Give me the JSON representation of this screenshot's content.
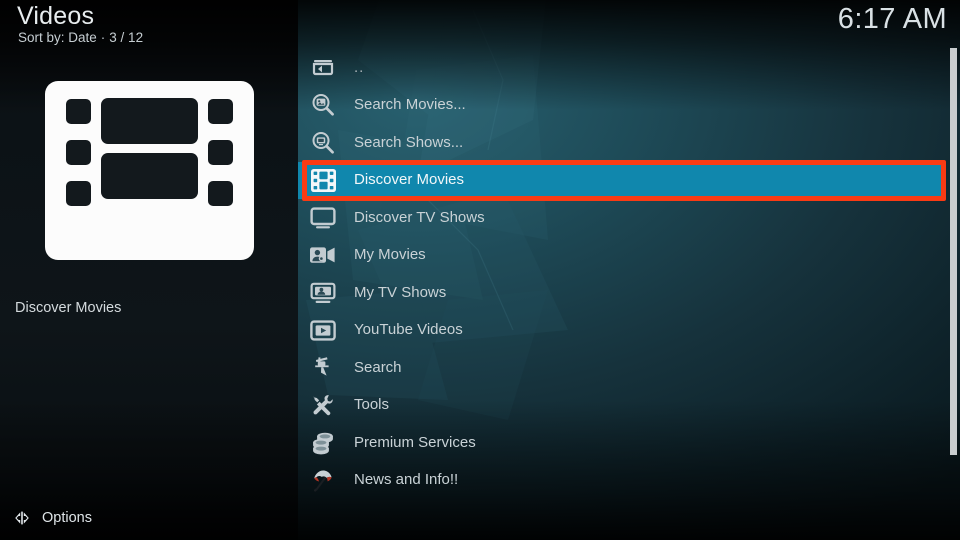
{
  "header": {
    "title": "Videos",
    "sort_label": "Sort by: Date",
    "separator": "·",
    "position": "3 / 12",
    "clock": "6:17 AM"
  },
  "info_panel": {
    "thumbnail_icon": "film-strip-icon",
    "label": "Discover Movies"
  },
  "footer": {
    "options_icon": "left-right-arrows-icon",
    "options_label": "Options"
  },
  "menu": {
    "selected_index": 3,
    "items": [
      {
        "label": "..",
        "icon": "parent-folder-icon"
      },
      {
        "label": "Search Movies...",
        "icon": "search-movies-icon"
      },
      {
        "label": "Search Shows...",
        "icon": "search-shows-icon"
      },
      {
        "label": "Discover Movies",
        "icon": "film-strip-icon"
      },
      {
        "label": "Discover TV Shows",
        "icon": "television-icon"
      },
      {
        "label": "My Movies",
        "icon": "person-camcorder-icon"
      },
      {
        "label": "My TV Shows",
        "icon": "monitor-person-icon"
      },
      {
        "label": "YouTube Videos",
        "icon": "video-play-icon"
      },
      {
        "label": "Search",
        "icon": "search-tool-icon"
      },
      {
        "label": "Tools",
        "icon": "wrench-screwdriver-icon"
      },
      {
        "label": "Premium Services",
        "icon": "coins-stack-icon"
      },
      {
        "label": "News and Info!!",
        "icon": "umbrella-icon"
      }
    ]
  },
  "colors": {
    "selection": "#1087ad",
    "annotation": "#fa3b14",
    "panel_background": "#1e4b58",
    "scrollbar": "#c9cdcf"
  },
  "scrollbar": {
    "visible": true
  }
}
